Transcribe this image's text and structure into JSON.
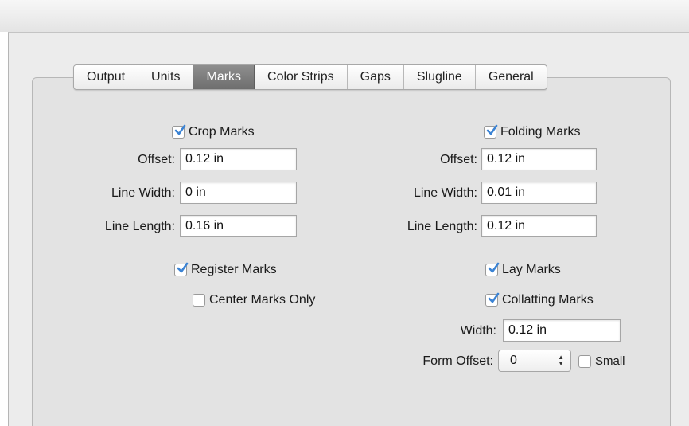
{
  "tabs": [
    {
      "label": "Output",
      "active": false
    },
    {
      "label": "Units",
      "active": false
    },
    {
      "label": "Marks",
      "active": true
    },
    {
      "label": "Color Strips",
      "active": false
    },
    {
      "label": "Gaps",
      "active": false
    },
    {
      "label": "Slugline",
      "active": false
    },
    {
      "label": "General",
      "active": false
    }
  ],
  "crop": {
    "label": "Crop Marks",
    "checked": true,
    "offset_label": "Offset:",
    "offset": "0.12 in",
    "line_width_label": "Line Width:",
    "line_width": "0 in",
    "line_length_label": "Line Length:",
    "line_length": "0.16 in"
  },
  "folding": {
    "label": "Folding Marks",
    "checked": true,
    "offset_label": "Offset:",
    "offset": "0.12 in",
    "line_width_label": "Line Width:",
    "line_width": "0.01 in",
    "line_length_label": "Line Length:",
    "line_length": "0.12 in"
  },
  "register": {
    "label": "Register Marks",
    "checked": true
  },
  "center_only": {
    "label": "Center Marks Only",
    "checked": false
  },
  "lay": {
    "label": "Lay Marks",
    "checked": true
  },
  "collating": {
    "label": "Collatting Marks",
    "checked": true,
    "width_label": "Width:",
    "width": "0.12 in",
    "form_offset_label": "Form Offset:",
    "form_offset": "0",
    "small_label": "Small",
    "small_checked": false
  },
  "colors": {
    "checkbox_accent": "#3b83d4",
    "active_tab": "#7d7d7d"
  }
}
